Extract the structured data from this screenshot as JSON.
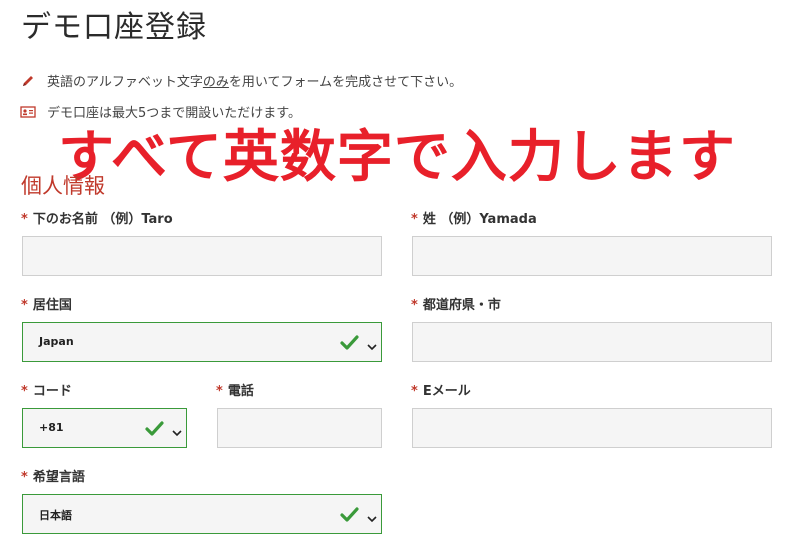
{
  "page": {
    "title": "デモ口座登録"
  },
  "notices": [
    {
      "icon": "pencil-icon",
      "text_before": "英語のアルファベット文字",
      "text_underlined": "のみ",
      "text_after": "を用いてフォームを完成させて下さい。"
    },
    {
      "icon": "id-card-icon",
      "text": "デモ口座は最大5つまで開設いただけます。"
    }
  ],
  "overlay": {
    "text": "すべて英数字で入力します"
  },
  "section": {
    "title": "個人情報"
  },
  "form": {
    "required_mark": "*",
    "first_name": {
      "label": "下のお名前 （例）Taro",
      "value": ""
    },
    "last_name": {
      "label": "姓 （例）Yamada",
      "value": ""
    },
    "country": {
      "label": "居住国",
      "value": "Japan"
    },
    "prefecture": {
      "label": "都道府県・市",
      "value": ""
    },
    "code": {
      "label": "コード",
      "value": "+81"
    },
    "phone": {
      "label": "電話",
      "value": ""
    },
    "email": {
      "label": "Eメール",
      "value": ""
    },
    "language": {
      "label": "希望言語",
      "value": "日本語"
    }
  },
  "colors": {
    "accent_red": "#e8202a",
    "section_red": "#c0392b",
    "valid_green": "#3a9a3a"
  }
}
